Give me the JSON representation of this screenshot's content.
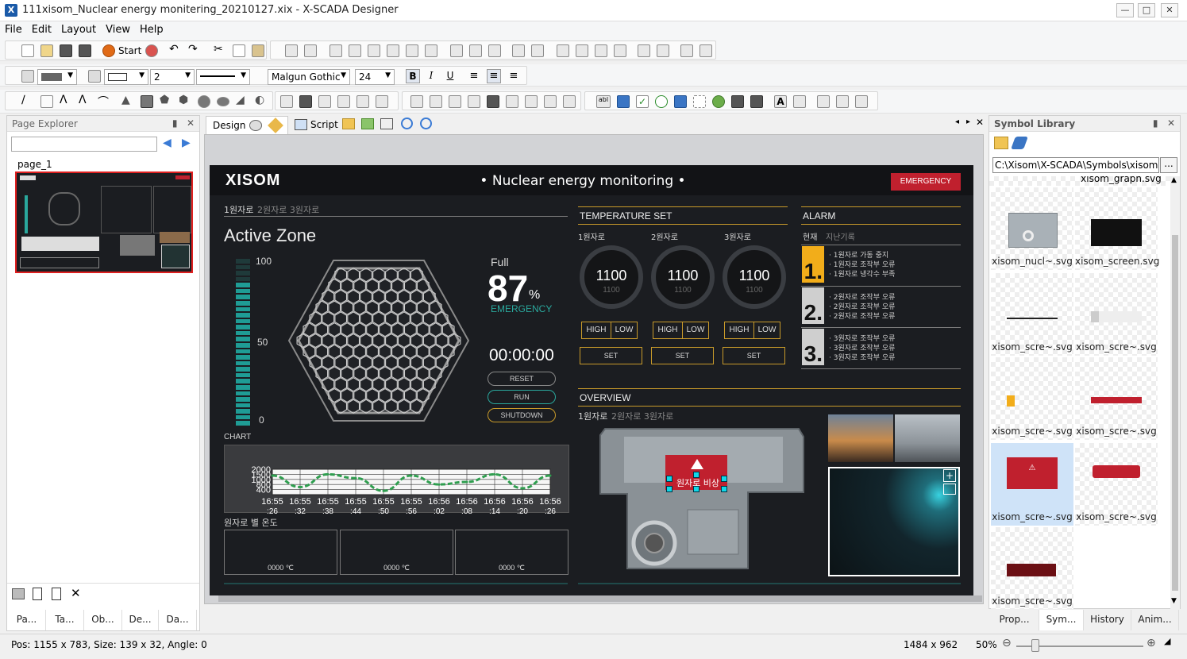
{
  "window": {
    "title": "111xisom_Nuclear energy monitering_20210127.xix - X-SCADA Designer",
    "logo": "X"
  },
  "menu": [
    "File",
    "Edit",
    "Layout",
    "View",
    "Help"
  ],
  "toolbar": {
    "start_label": "Start",
    "line_width": "2",
    "font_name": "Malgun Gothic",
    "font_size": "24",
    "bold": "B",
    "italic": "I",
    "underline": "U"
  },
  "page_explorer": {
    "title": "Page Explorer",
    "search_placeholder": "",
    "page_name": "page_1"
  },
  "editor_tabs": [
    {
      "label": "Design"
    },
    {
      "label": "Script"
    }
  ],
  "hmi": {
    "brand": "XISOM",
    "header_title": "• Nuclear energy monitoring •",
    "emergency_button": "EMERGENCY",
    "reactor_tabs_active": "1원자로",
    "reactor_tabs_rest": "2원자로 3원자로",
    "active_zone": "Active Zone",
    "gauge": {
      "top": "100",
      "mid": "50",
      "bottom": "0",
      "level": 0.87
    },
    "full_label": "Full",
    "full_value": "87",
    "full_unit": "%",
    "full_status": "EMERGENCY",
    "timer": "00:00:00",
    "buttons": [
      "RESET",
      "RUN",
      "SHUTDOWN"
    ],
    "chart_label": "CHART",
    "temp_label": "원자로 별 온도",
    "temp_values": [
      "0000 ℃",
      "0000 ℃",
      "0000 ℃"
    ],
    "temperature_set": {
      "title": "TEMPERATURE SET",
      "reactors": [
        {
          "name": "1원자로",
          "value": "1100",
          "sub": "1100"
        },
        {
          "name": "2원자로",
          "value": "1100",
          "sub": "1100"
        },
        {
          "name": "3원자로",
          "value": "1100",
          "sub": "1100"
        }
      ],
      "high": "HIGH",
      "low": "LOW",
      "set": "SET"
    },
    "alarm": {
      "title": "ALARM",
      "tab_active": "현재",
      "tab_other": "지난기록",
      "groups": [
        {
          "num": "1.",
          "items": [
            "· 1원자로 가동 중지",
            "· 1원자로 조작부 오류",
            "· 1원자로 냉각수 부족"
          ]
        },
        {
          "num": "2.",
          "items": [
            "· 2원자로 조작부 오류",
            "· 2원자로 조작부 오류",
            "· 2원자로 조작부 오류"
          ]
        },
        {
          "num": "3.",
          "items": [
            "· 3원자로 조작부 오류",
            "· 3원자로 조작부 오류",
            "· 3원자로 조작부 오류"
          ]
        }
      ]
    },
    "overview": {
      "title": "OVERVIEW",
      "tab_active": "1원자로",
      "tab_rest": "2원자로 3원자로",
      "warning_label": "원자로 비상"
    }
  },
  "chart_data": {
    "type": "line",
    "x": [
      "16:55 :26",
      "16:55 :32",
      "16:55 :38",
      "16:55 :44",
      "16:55 :50",
      "16:55 :56",
      "16:56 :02",
      "16:56 :08",
      "16:56 :14",
      "16:56 :20",
      "16:56 :26"
    ],
    "y_ticks": [
      "2000",
      "1500",
      "1000",
      "800",
      "400"
    ],
    "ylim": [
      0,
      2000
    ],
    "series": [
      {
        "values": [
          1500,
          600,
          1600,
          1300,
          300,
          1500,
          800,
          1000,
          1600,
          500,
          1500
        ],
        "color": "#2f9e4f"
      }
    ],
    "grid": true
  },
  "symbol_library": {
    "title": "Symbol Library",
    "path": "C:\\Xisom\\X-SCADA\\Symbols\\xisom",
    "browse": "...",
    "top_label": "xisom_graph.svg",
    "items": [
      "xisom_nucl~.svg",
      "xisom_screen.svg",
      "xisom_scre~.svg",
      "xisom_scre~.svg",
      "xisom_scre~.svg",
      "xisom_scre~.svg",
      "xisom_scre~.svg",
      "xisom_scre~.svg",
      "xisom_scre~.svg"
    ]
  },
  "left_tabs": [
    "Pa...",
    "Ta...",
    "Ob...",
    "De...",
    "Da..."
  ],
  "right_tabs": [
    "Prop...",
    "Sym...",
    "History",
    "Anim..."
  ],
  "status": {
    "pos": "Pos: 1155 x 783, Size: 139 x 32, Angle: 0",
    "resolution": "1484 x 962",
    "zoom": "50%",
    "zoom_level": 0.5
  }
}
